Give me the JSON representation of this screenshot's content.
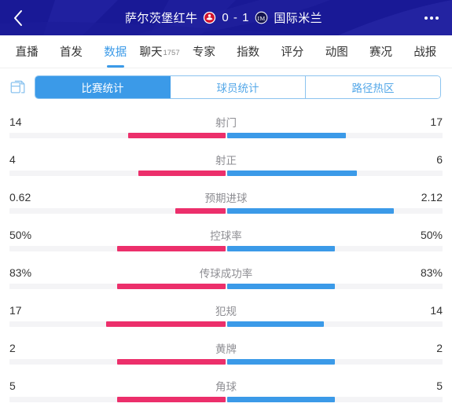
{
  "header": {
    "back_icon": "chevron-left-icon",
    "more_icon": "more-horizontal-icon",
    "home_team": "萨尔茨堡红牛",
    "away_team": "国际米兰",
    "score": "0 - 1",
    "home_logo": "salzburg-crest-icon",
    "away_logo": "inter-milan-crest-icon",
    "bg_color": "#191996"
  },
  "nav": {
    "items": [
      {
        "label": "直播",
        "sup": "",
        "active": false
      },
      {
        "label": "首发",
        "sup": "",
        "active": false
      },
      {
        "label": "数据",
        "sup": "",
        "active": true
      },
      {
        "label": "聊天",
        "sup": "1757",
        "active": false
      },
      {
        "label": "专家",
        "sup": "",
        "active": false
      },
      {
        "label": "指数",
        "sup": "",
        "active": false
      },
      {
        "label": "评分",
        "sup": "",
        "active": false
      },
      {
        "label": "动图",
        "sup": "",
        "active": false
      },
      {
        "label": "赛况",
        "sup": "",
        "active": false
      },
      {
        "label": "战报",
        "sup": "",
        "active": false
      }
    ],
    "active_color": "#3b9ae8"
  },
  "toolbar": {
    "doc_icon": "document-copy-icon",
    "segments": [
      {
        "label": "比赛统计",
        "active": true
      },
      {
        "label": "球员统计",
        "active": false
      },
      {
        "label": "路径热区",
        "active": false
      }
    ]
  },
  "chart_data": {
    "type": "bar",
    "title": "比赛统计",
    "orientation": "diverging-horizontal",
    "left_color": "#ec2f6b",
    "right_color": "#3b9ae8",
    "track_color": "#f4f4f6",
    "series": [
      {
        "name": "萨尔茨堡红牛",
        "side": "left",
        "color": "#ec2f6b"
      },
      {
        "name": "国际米兰",
        "side": "right",
        "color": "#3b9ae8"
      }
    ],
    "categories": [
      "射门",
      "射正",
      "预期进球",
      "控球率",
      "传球成功率",
      "犯规",
      "黄牌",
      "角球"
    ],
    "rows": [
      {
        "label": "射门",
        "left": "14",
        "right": "17",
        "left_pct": 45,
        "right_pct": 55
      },
      {
        "label": "射正",
        "left": "4",
        "right": "6",
        "left_pct": 40,
        "right_pct": 60
      },
      {
        "label": "预期进球",
        "left": "0.62",
        "right": "2.12",
        "left_pct": 23,
        "right_pct": 77
      },
      {
        "label": "控球率",
        "left": "50%",
        "right": "50%",
        "left_pct": 50,
        "right_pct": 50
      },
      {
        "label": "传球成功率",
        "left": "83%",
        "right": "83%",
        "left_pct": 50,
        "right_pct": 50
      },
      {
        "label": "犯规",
        "left": "17",
        "right": "14",
        "left_pct": 55,
        "right_pct": 45
      },
      {
        "label": "黄牌",
        "left": "2",
        "right": "2",
        "left_pct": 50,
        "right_pct": 50
      },
      {
        "label": "角球",
        "left": "5",
        "right": "5",
        "left_pct": 50,
        "right_pct": 50
      }
    ]
  }
}
